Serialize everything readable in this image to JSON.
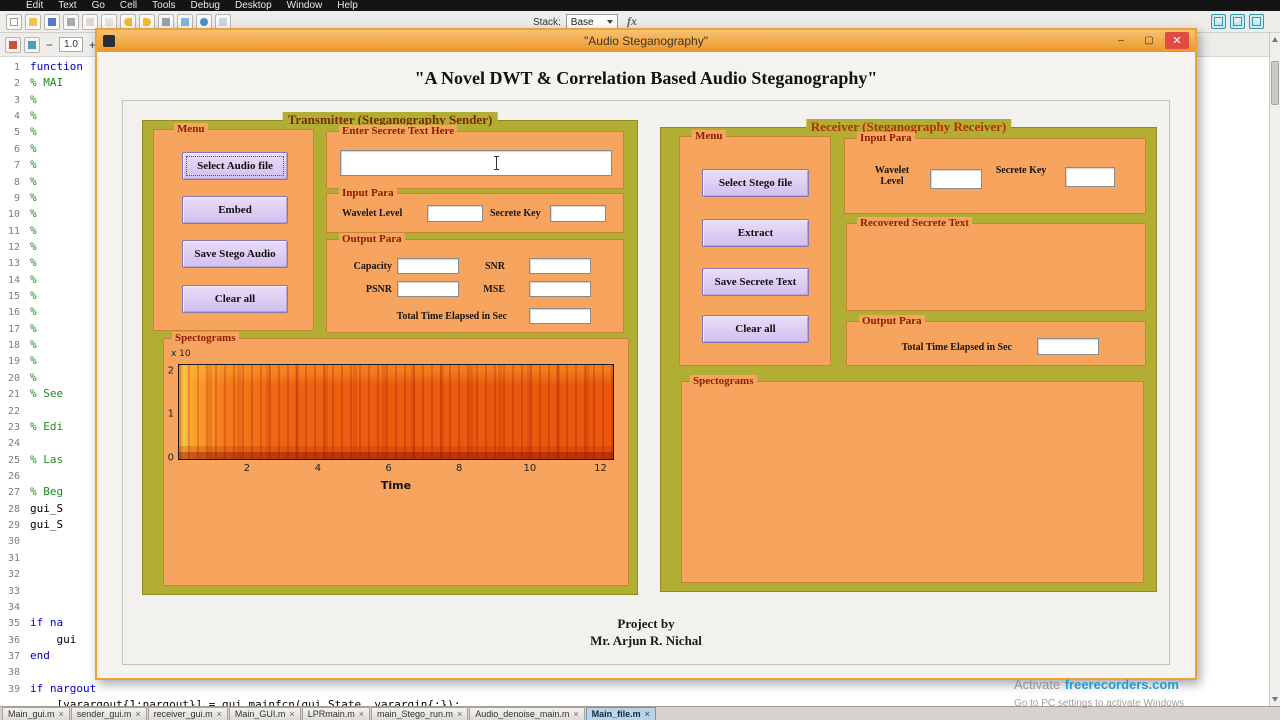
{
  "matlab": {
    "menu_items": [
      "Edit",
      "Text",
      "Go",
      "Cell",
      "Tools",
      "Debug",
      "Desktop",
      "Window",
      "Help"
    ],
    "toolbar": {
      "stack_label": "Stack:",
      "stack_value": "Base",
      "fx_label": "fx",
      "icons": [
        "new-file-icon",
        "open-file-icon",
        "save-icon",
        "cut-icon",
        "copy-icon",
        "paste-icon",
        "undo-icon",
        "redo-icon",
        "print-icon",
        "find-files-icon",
        "help-icon",
        "desktop-layout-icon"
      ],
      "right_icons": [
        "grid-layout-icon",
        "dock-editor-icon",
        "close-panel-icon"
      ]
    },
    "editor_toolbar": {
      "icons": [
        "insert-cell-icon",
        "publish-icon"
      ],
      "minus_glyph": "−",
      "divide_value": "1.0",
      "plus_glyph": "+"
    },
    "tab_close_glyph": "×",
    "editor": {
      "lines": [
        {
          "n": "1",
          "code": "function",
          "cls": "kw"
        },
        {
          "n": "2",
          "code": "% MAI",
          "cls": "cm"
        },
        {
          "n": "3",
          "code": "%",
          "cls": "cm"
        },
        {
          "n": "4",
          "code": "%",
          "cls": "cm"
        },
        {
          "n": "5",
          "code": "%",
          "cls": "cm"
        },
        {
          "n": "6",
          "code": "%",
          "cls": "cm"
        },
        {
          "n": "7",
          "code": "%",
          "cls": "cm"
        },
        {
          "n": "8",
          "code": "%",
          "cls": "cm"
        },
        {
          "n": "9",
          "code": "%",
          "cls": "cm"
        },
        {
          "n": "10",
          "code": "%",
          "cls": "cm"
        },
        {
          "n": "11",
          "code": "%",
          "cls": "cm"
        },
        {
          "n": "12",
          "code": "%",
          "cls": "cm"
        },
        {
          "n": "13",
          "code": "%",
          "cls": "cm"
        },
        {
          "n": "14",
          "code": "%",
          "cls": "cm"
        },
        {
          "n": "15",
          "code": "%",
          "cls": "cm"
        },
        {
          "n": "16",
          "code": "%",
          "cls": "cm"
        },
        {
          "n": "17",
          "code": "%",
          "cls": "cm"
        },
        {
          "n": "18",
          "code": "%",
          "cls": "cm"
        },
        {
          "n": "19",
          "code": "%",
          "cls": "cm"
        },
        {
          "n": "20",
          "code": "%",
          "cls": "cm"
        },
        {
          "n": "21",
          "code": "% See",
          "cls": "cm"
        },
        {
          "n": "22",
          "code": "",
          "cls": "tx"
        },
        {
          "n": "23",
          "code": "% Edi",
          "cls": "cm"
        },
        {
          "n": "24",
          "code": "",
          "cls": "tx"
        },
        {
          "n": "25",
          "code": "% Las",
          "cls": "cm"
        },
        {
          "n": "26",
          "code": "",
          "cls": "tx"
        },
        {
          "n": "27",
          "code": "% Beg",
          "cls": "cm"
        },
        {
          "n": "28",
          "code": "gui_S",
          "cls": "tx"
        },
        {
          "n": "29",
          "code": "gui_S",
          "cls": "tx"
        },
        {
          "n": "30",
          "code": "",
          "cls": "tx"
        },
        {
          "n": "31",
          "code": "",
          "cls": "tx"
        },
        {
          "n": "32",
          "code": "",
          "cls": "tx"
        },
        {
          "n": "33",
          "code": "",
          "cls": "tx"
        },
        {
          "n": "34",
          "code": "",
          "cls": "tx"
        },
        {
          "n": "35",
          "code": "if na",
          "cls": "kw"
        },
        {
          "n": "36",
          "code": "    gui",
          "cls": "tx"
        },
        {
          "n": "37",
          "code": "end",
          "cls": "kw"
        },
        {
          "n": "38",
          "code": "",
          "cls": "tx"
        },
        {
          "n": "39",
          "code": "if nargout",
          "cls": "kw"
        },
        {
          "n": "",
          "code": "    [varargout{1:nargout}] = gui_mainfcn(gui_State, varargin{:});",
          "cls": "tx"
        }
      ]
    },
    "tabs": [
      {
        "label": "Main_gui.m",
        "cls": ""
      },
      {
        "label": "sender_gui.m",
        "cls": ""
      },
      {
        "label": "receiver_gui.m",
        "cls": ""
      },
      {
        "label": "Main_GUI.m",
        "cls": ""
      },
      {
        "label": "LPRmain.m",
        "cls": ""
      },
      {
        "label": "main_Stego_run.m",
        "cls": ""
      },
      {
        "label": "Audio_denoise_main.m",
        "cls": ""
      },
      {
        "label": "Main_file.m",
        "cls": "active"
      }
    ]
  },
  "window": {
    "title": "\"Audio Steganography\"",
    "heading": "\"A Novel DWT & Correlation Based Audio Steganography\"",
    "footer_line1": "Project by",
    "footer_line2": "Mr. Arjun R. Nichal",
    "controls": {
      "minimize_glyph": "–",
      "maximize_glyph": "▢",
      "close_glyph": "✕"
    }
  },
  "transmitter": {
    "title": "Transmitter (Steganography Sender)",
    "menu": {
      "title": "Menu",
      "buttons": [
        "Select Audio file",
        "Embed",
        "Save Stego Audio",
        "Clear all"
      ]
    },
    "secret_text": {
      "title": "Enter Secrete Text Here",
      "value": ""
    },
    "input_para": {
      "title": "Input Para",
      "wavelet_label": "Wavelet Level",
      "wavelet_value": "",
      "key_label": "Secrete Key",
      "key_value": ""
    },
    "output_para": {
      "title": "Output Para",
      "capacity_label": "Capacity",
      "capacity_value": "",
      "snr_label": "SNR",
      "snr_value": "",
      "psnr_label": "PSNR",
      "psnr_value": "",
      "mse_label": "MSE",
      "mse_value": "",
      "time_label": "Total Time Elapsed in Sec",
      "time_value": ""
    },
    "spectrogram": {
      "title": "Spectograms",
      "xlabel": "Time",
      "x_ticks": [
        "2",
        "4",
        "6",
        "8",
        "10",
        "12"
      ],
      "y_ticks": [
        "2",
        "1",
        "0"
      ],
      "y_scale": "x 10"
    }
  },
  "receiver": {
    "title": "Receiver (Steganography Receiver)",
    "menu": {
      "title": "Menu",
      "buttons": [
        "Select Stego file",
        "Extract",
        "Save Secrete Text",
        "Clear all"
      ]
    },
    "input_para": {
      "title": "Input Para",
      "wavelet_label": "Wavelet Level",
      "wavelet_value": "",
      "key_label": "Secrete Key",
      "key_value": ""
    },
    "recovered": {
      "title": "Recovered Secrete Text",
      "value": ""
    },
    "output_para": {
      "title": "Output Para",
      "time_label": "Total Time Elapsed in Sec",
      "time_value": ""
    },
    "spectrogram": {
      "title": "Spectograms"
    }
  },
  "watermark": {
    "prefix": "Activate",
    "brand": "freerecorders.com",
    "line2": "Go to PC settings to activate Windows"
  },
  "chart_data": {
    "type": "heatmap",
    "title": "Spectograms (transmitter audio spectrogram)",
    "xlabel": "Time",
    "x_ticks": [
      2,
      4,
      6,
      8,
      10,
      12
    ],
    "xlim": [
      0,
      12.4
    ],
    "y_ticks": [
      0,
      1,
      2
    ],
    "y_scale_label": "x 10",
    "ylim": [
      0,
      2
    ],
    "legend": "none",
    "description": "Dense orange-red audio spectrogram filling the axes; brighter yellow-orange intensity at the left onset fading to deep red-orange, with many dark-red vertical streaks across the full time range; no numeric data labels shown"
  }
}
